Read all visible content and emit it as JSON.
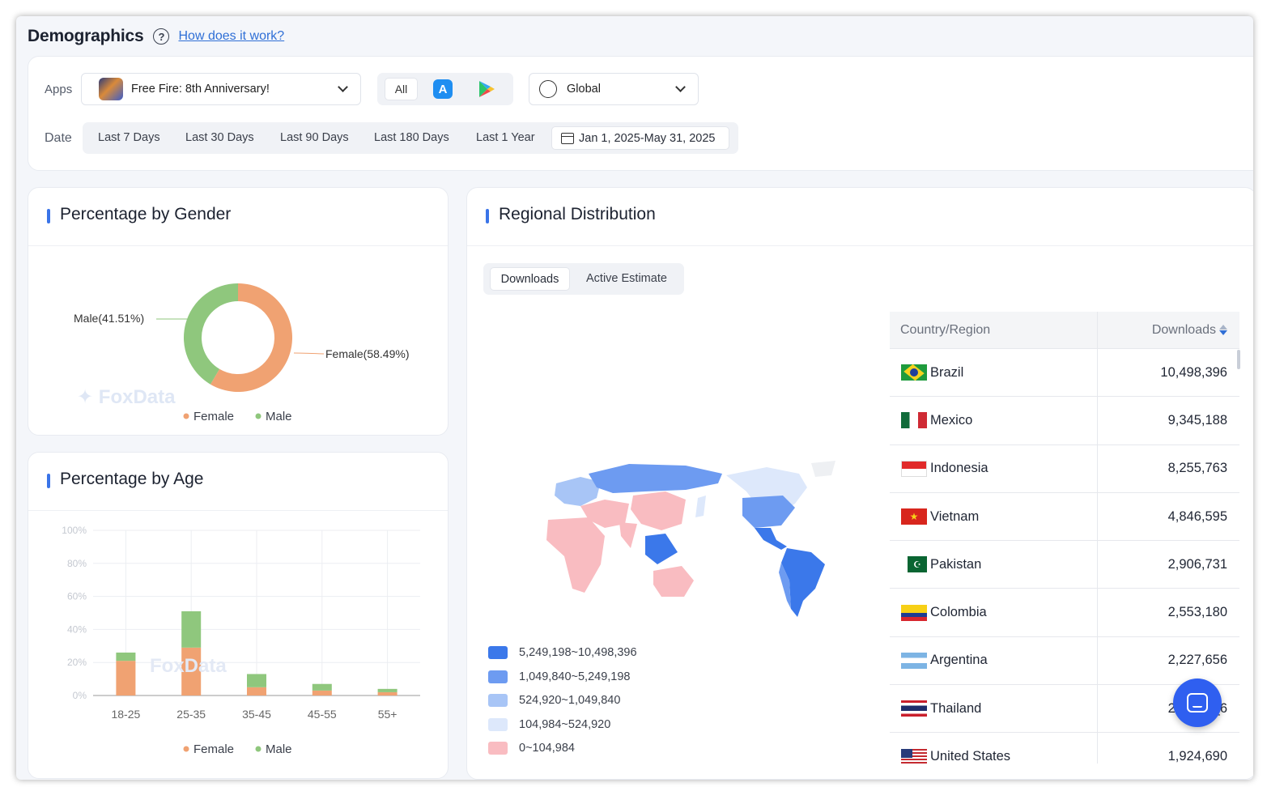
{
  "page": {
    "title": "Demographics",
    "help_link": "How does it work?"
  },
  "filters": {
    "apps_label": "Apps",
    "app_name": "Free Fire: 8th Anniversary!",
    "store_all": "All",
    "region": "Global",
    "date_label": "Date",
    "date_options": [
      "Last 7 Days",
      "Last 30 Days",
      "Last 90 Days",
      "Last 180 Days",
      "Last 1 Year"
    ],
    "date_range": "Jan 1, 2025-May 31, 2025"
  },
  "gender": {
    "title": "Percentage by Gender",
    "watermark": "FoxData",
    "legend": [
      "Female",
      "Male"
    ],
    "colors": {
      "female": "#f0a272",
      "male": "#8fc77d"
    }
  },
  "age": {
    "title": "Percentage by Age",
    "watermark": "FoxData",
    "legend": [
      "Female",
      "Male"
    ]
  },
  "regional": {
    "title": "Regional Distribution",
    "tabs": [
      "Downloads",
      "Active Estimate"
    ],
    "legend": [
      {
        "label": "5,249,198~10,498,396",
        "color": "#3b78ea"
      },
      {
        "label": "1,049,840~5,249,198",
        "color": "#6d9bf1"
      },
      {
        "label": "524,920~1,049,840",
        "color": "#a8c5f6"
      },
      {
        "label": "104,984~524,920",
        "color": "#dde8fb"
      },
      {
        "label": "0~104,984",
        "color": "#f9bcc1"
      }
    ],
    "table": {
      "col_country": "Country/Region",
      "col_downloads": "Downloads",
      "rows": [
        {
          "country": "Brazil",
          "downloads": "10,498,396"
        },
        {
          "country": "Mexico",
          "downloads": "9,345,188"
        },
        {
          "country": "Indonesia",
          "downloads": "8,255,763"
        },
        {
          "country": "Vietnam",
          "downloads": "4,846,595"
        },
        {
          "country": "Pakistan",
          "downloads": "2,906,731"
        },
        {
          "country": "Colombia",
          "downloads": "2,553,180"
        },
        {
          "country": "Argentina",
          "downloads": "2,227,656"
        },
        {
          "country": "Thailand",
          "downloads": "2,___,__6"
        },
        {
          "country": "United States",
          "downloads": "1,924,690"
        }
      ]
    }
  },
  "chart_data": [
    {
      "type": "pie",
      "labels": [
        "Female",
        "Male"
      ],
      "values": [
        58.49,
        41.51
      ],
      "slice_labels": [
        "Female(58.49%)",
        "Male(41.51%)"
      ],
      "legend": "bottom"
    },
    {
      "type": "bar",
      "stacked": true,
      "categories": [
        "18-25",
        "25-35",
        "35-45",
        "45-55",
        "55+"
      ],
      "series": [
        {
          "name": "Female",
          "values": [
            21,
            29,
            5,
            3,
            2
          ]
        },
        {
          "name": "Male",
          "values": [
            5,
            22,
            8,
            4,
            2
          ]
        }
      ],
      "ylim": [
        0,
        100
      ],
      "yticks": [
        "0%",
        "20%",
        "40%",
        "60%",
        "80%",
        "100%"
      ],
      "grid": true,
      "legend": "bottom"
    }
  ]
}
